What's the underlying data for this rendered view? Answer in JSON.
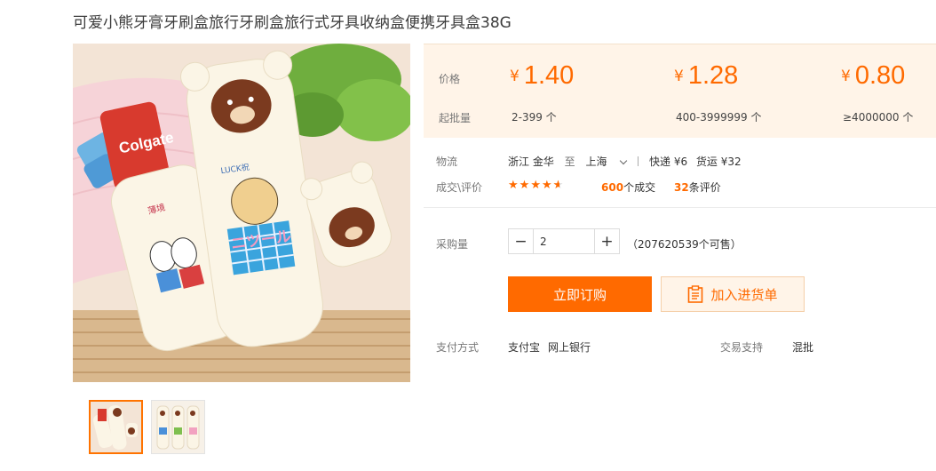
{
  "product": {
    "title": "可爱小熊牙膏牙刷盒旅行牙刷盒旅行式牙具收纳盒便携牙具盒38G",
    "image_texts": {
      "toothpaste": "Colgate",
      "cup_label": "LUCK祝",
      "kana": "ニツール",
      "box_text": "薄境"
    }
  },
  "price_panel": {
    "price_label": "价格",
    "moq_label": "起批量",
    "currency": "¥",
    "tiers": [
      {
        "price": "1.40",
        "range": "2-399 个"
      },
      {
        "price": "1.28",
        "range": "400-3999999 个"
      },
      {
        "price": "0.80",
        "range": "≥4000000 个"
      }
    ]
  },
  "logistics": {
    "label": "物流",
    "from": "浙江 金华",
    "to_word": "至",
    "to": "上海",
    "express": "快递 ¥6",
    "freight": "货运 ¥32"
  },
  "reviews": {
    "label": "成交\\评价",
    "rating": 4.5,
    "deals_count": "600",
    "deals_suffix": "个成交",
    "reviews_count": "32",
    "reviews_suffix": "条评价"
  },
  "purchase": {
    "label": "采购量",
    "quantity": "2",
    "available": "（207620539个可售）",
    "order_button": "立即订购",
    "cart_button": "加入进货单"
  },
  "payment": {
    "label": "支付方式",
    "methods": [
      "支付宝",
      "网上银行"
    ],
    "support_label": "交易支持",
    "support_value": "混批"
  },
  "colors": {
    "accent": "#ff6a00",
    "panel_bg": "#fff4e8"
  }
}
